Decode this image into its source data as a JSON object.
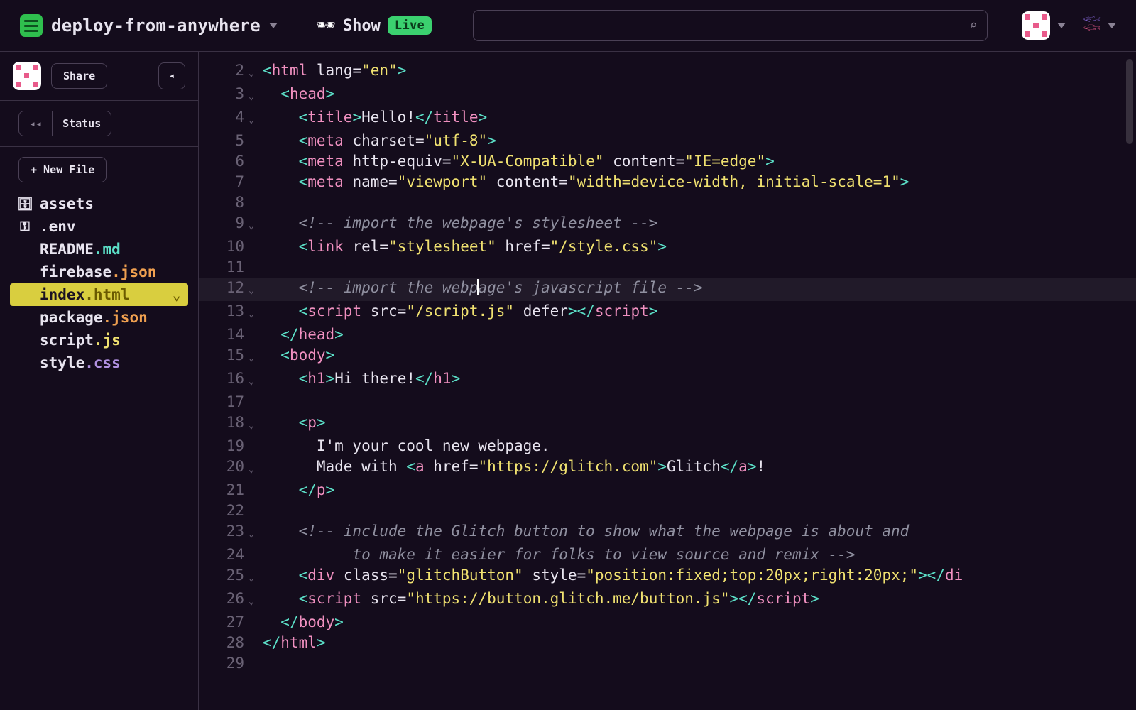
{
  "header": {
    "project_name": "deploy-from-anywhere",
    "show_label": "Show",
    "live_label": "Live",
    "search_placeholder": ""
  },
  "sidebar": {
    "share_label": "Share",
    "status_label": "Status",
    "new_file_label": "+ New File",
    "files": [
      {
        "icon": "archive",
        "name": "assets",
        "ext": "",
        "ext_class": ""
      },
      {
        "icon": "key",
        "name": ".env",
        "ext": "",
        "ext_class": ""
      },
      {
        "icon": "",
        "name": "README",
        "ext": ".md",
        "ext_class": "ext-md"
      },
      {
        "icon": "",
        "name": "firebase",
        "ext": ".json",
        "ext_class": "ext-json"
      },
      {
        "icon": "",
        "name": "index",
        "ext": ".html",
        "ext_class": "ext-html",
        "selected": true
      },
      {
        "icon": "",
        "name": "package",
        "ext": ".json",
        "ext_class": "ext-json"
      },
      {
        "icon": "",
        "name": "script",
        "ext": ".js",
        "ext_class": "ext-js"
      },
      {
        "icon": "",
        "name": "style",
        "ext": ".css",
        "ext_class": "ext-css"
      }
    ]
  },
  "editor": {
    "active_file": "index.html",
    "highlighted_line": 12,
    "lines": [
      {
        "n": 2,
        "fold": true,
        "indent": 0,
        "tokens": [
          [
            "punct",
            "<"
          ],
          [
            "tag",
            "html"
          ],
          [
            "text",
            " "
          ],
          [
            "attr",
            "lang="
          ],
          [
            "str",
            "\"en\""
          ],
          [
            "punct",
            ">"
          ]
        ]
      },
      {
        "n": 3,
        "fold": true,
        "indent": 1,
        "tokens": [
          [
            "punct",
            "<"
          ],
          [
            "tag",
            "head"
          ],
          [
            "punct",
            ">"
          ]
        ]
      },
      {
        "n": 4,
        "fold": true,
        "indent": 2,
        "tokens": [
          [
            "punct",
            "<"
          ],
          [
            "tag",
            "title"
          ],
          [
            "punct",
            ">"
          ],
          [
            "text",
            "Hello!"
          ],
          [
            "punct",
            "</"
          ],
          [
            "tag",
            "title"
          ],
          [
            "punct",
            ">"
          ]
        ]
      },
      {
        "n": 5,
        "fold": false,
        "indent": 2,
        "tokens": [
          [
            "punct",
            "<"
          ],
          [
            "tag",
            "meta"
          ],
          [
            "text",
            " "
          ],
          [
            "attr",
            "charset="
          ],
          [
            "str",
            "\"utf-8\""
          ],
          [
            "punct",
            ">"
          ]
        ]
      },
      {
        "n": 6,
        "fold": false,
        "indent": 2,
        "tokens": [
          [
            "punct",
            "<"
          ],
          [
            "tag",
            "meta"
          ],
          [
            "text",
            " "
          ],
          [
            "attr",
            "http-equiv="
          ],
          [
            "str",
            "\"X-UA-Compatible\""
          ],
          [
            "text",
            " "
          ],
          [
            "attr",
            "content="
          ],
          [
            "str",
            "\"IE=edge\""
          ],
          [
            "punct",
            ">"
          ]
        ]
      },
      {
        "n": 7,
        "fold": false,
        "indent": 2,
        "tokens": [
          [
            "punct",
            "<"
          ],
          [
            "tag",
            "meta"
          ],
          [
            "text",
            " "
          ],
          [
            "attr",
            "name="
          ],
          [
            "str",
            "\"viewport\""
          ],
          [
            "text",
            " "
          ],
          [
            "attr",
            "content="
          ],
          [
            "str",
            "\"width=device-width, initial-scale=1\""
          ],
          [
            "punct",
            ">"
          ]
        ]
      },
      {
        "n": 8,
        "fold": false,
        "indent": 0,
        "tokens": []
      },
      {
        "n": 9,
        "fold": true,
        "indent": 2,
        "tokens": [
          [
            "comment",
            "<!-- import the webpage's stylesheet -->"
          ]
        ]
      },
      {
        "n": 10,
        "fold": false,
        "indent": 2,
        "tokens": [
          [
            "punct",
            "<"
          ],
          [
            "tag",
            "link"
          ],
          [
            "text",
            " "
          ],
          [
            "attr",
            "rel="
          ],
          [
            "str",
            "\"stylesheet\""
          ],
          [
            "text",
            " "
          ],
          [
            "attr",
            "href="
          ],
          [
            "str",
            "\"/style.css\""
          ],
          [
            "punct",
            ">"
          ]
        ]
      },
      {
        "n": 11,
        "fold": false,
        "indent": 0,
        "tokens": []
      },
      {
        "n": 12,
        "fold": true,
        "indent": 2,
        "hl": true,
        "cursor_at": 20,
        "tokens": [
          [
            "comment",
            "<!-- import the webpage's javascript file -->"
          ]
        ]
      },
      {
        "n": 13,
        "fold": true,
        "indent": 2,
        "tokens": [
          [
            "punct",
            "<"
          ],
          [
            "tag",
            "script"
          ],
          [
            "text",
            " "
          ],
          [
            "attr",
            "src="
          ],
          [
            "str",
            "\"/script.js\""
          ],
          [
            "text",
            " "
          ],
          [
            "attr",
            "defer"
          ],
          [
            "punct",
            ">"
          ],
          [
            "punct",
            "</"
          ],
          [
            "tag",
            "script"
          ],
          [
            "punct",
            ">"
          ]
        ]
      },
      {
        "n": 14,
        "fold": false,
        "indent": 1,
        "tokens": [
          [
            "punct",
            "</"
          ],
          [
            "tag",
            "head"
          ],
          [
            "punct",
            ">"
          ]
        ]
      },
      {
        "n": 15,
        "fold": true,
        "indent": 1,
        "tokens": [
          [
            "punct",
            "<"
          ],
          [
            "tag",
            "body"
          ],
          [
            "punct",
            ">"
          ]
        ]
      },
      {
        "n": 16,
        "fold": true,
        "indent": 2,
        "tokens": [
          [
            "punct",
            "<"
          ],
          [
            "tag",
            "h1"
          ],
          [
            "punct",
            ">"
          ],
          [
            "text",
            "Hi there!"
          ],
          [
            "punct",
            "</"
          ],
          [
            "tag",
            "h1"
          ],
          [
            "punct",
            ">"
          ]
        ]
      },
      {
        "n": 17,
        "fold": false,
        "indent": 0,
        "tokens": []
      },
      {
        "n": 18,
        "fold": true,
        "indent": 2,
        "tokens": [
          [
            "punct",
            "<"
          ],
          [
            "tag",
            "p"
          ],
          [
            "punct",
            ">"
          ]
        ]
      },
      {
        "n": 19,
        "fold": false,
        "indent": 3,
        "tokens": [
          [
            "text",
            "I'm your cool new webpage."
          ]
        ]
      },
      {
        "n": 20,
        "fold": true,
        "indent": 3,
        "tokens": [
          [
            "text",
            "Made with "
          ],
          [
            "punct",
            "<"
          ],
          [
            "tag",
            "a"
          ],
          [
            "text",
            " "
          ],
          [
            "attr",
            "href="
          ],
          [
            "str",
            "\"https://glitch.com\""
          ],
          [
            "punct",
            ">"
          ],
          [
            "text",
            "Glitch"
          ],
          [
            "punct",
            "</"
          ],
          [
            "tag",
            "a"
          ],
          [
            "punct",
            ">"
          ],
          [
            "text",
            "!"
          ]
        ]
      },
      {
        "n": 21,
        "fold": false,
        "indent": 2,
        "tokens": [
          [
            "punct",
            "</"
          ],
          [
            "tag",
            "p"
          ],
          [
            "punct",
            ">"
          ]
        ]
      },
      {
        "n": 22,
        "fold": false,
        "indent": 0,
        "tokens": []
      },
      {
        "n": 23,
        "fold": true,
        "indent": 2,
        "tokens": [
          [
            "comment",
            "<!-- include the Glitch button to show what the webpage is about and"
          ]
        ]
      },
      {
        "n": 24,
        "fold": false,
        "indent": 5,
        "tokens": [
          [
            "comment",
            "to make it easier for folks to view source and remix -->"
          ]
        ]
      },
      {
        "n": 25,
        "fold": true,
        "indent": 2,
        "tokens": [
          [
            "punct",
            "<"
          ],
          [
            "tag",
            "div"
          ],
          [
            "text",
            " "
          ],
          [
            "attr",
            "class="
          ],
          [
            "str",
            "\"glitchButton\""
          ],
          [
            "text",
            " "
          ],
          [
            "attr",
            "style="
          ],
          [
            "str",
            "\"position:fixed;top:20px;right:20px;\""
          ],
          [
            "punct",
            ">"
          ],
          [
            "punct",
            "</"
          ],
          [
            "tag",
            "di"
          ]
        ]
      },
      {
        "n": 26,
        "fold": true,
        "indent": 2,
        "tokens": [
          [
            "punct",
            "<"
          ],
          [
            "tag",
            "script"
          ],
          [
            "text",
            " "
          ],
          [
            "attr",
            "src="
          ],
          [
            "str",
            "\"https://button.glitch.me/button.js\""
          ],
          [
            "punct",
            ">"
          ],
          [
            "punct",
            "</"
          ],
          [
            "tag",
            "script"
          ],
          [
            "punct",
            ">"
          ]
        ]
      },
      {
        "n": 27,
        "fold": false,
        "indent": 1,
        "tokens": [
          [
            "punct",
            "</"
          ],
          [
            "tag",
            "body"
          ],
          [
            "punct",
            ">"
          ]
        ]
      },
      {
        "n": 28,
        "fold": false,
        "indent": 0,
        "tokens": [
          [
            "punct",
            "</"
          ],
          [
            "tag",
            "html"
          ],
          [
            "punct",
            ">"
          ]
        ]
      },
      {
        "n": 29,
        "fold": false,
        "indent": 0,
        "tokens": []
      }
    ]
  }
}
